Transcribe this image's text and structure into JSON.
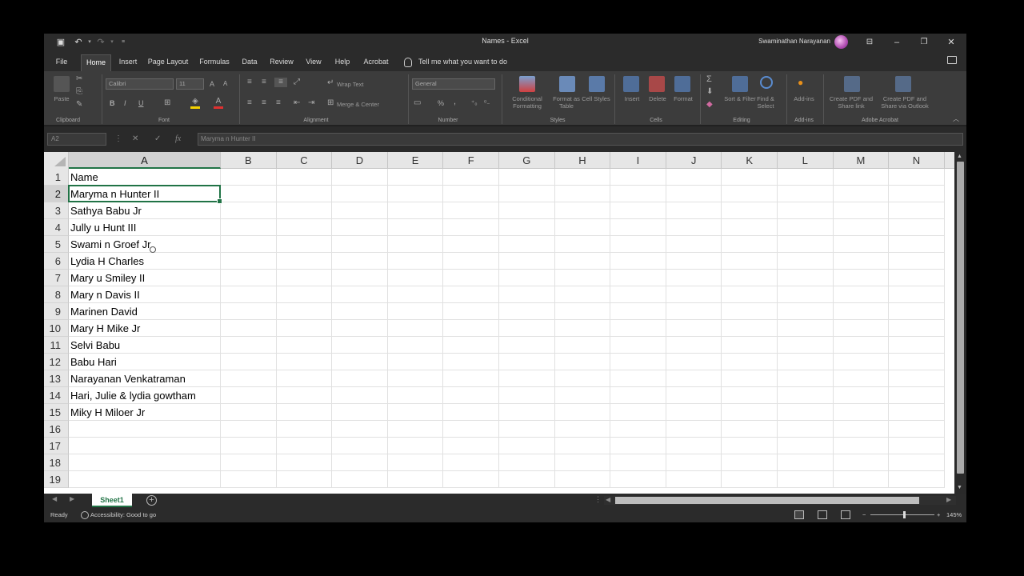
{
  "window": {
    "title": "Names - Excel",
    "user": "Swaminathan Narayanan"
  },
  "tabs": [
    "File",
    "Home",
    "Insert",
    "Page Layout",
    "Formulas",
    "Data",
    "Review",
    "View",
    "Help",
    "Acrobat"
  ],
  "active_tab": "Home",
  "tell_me": "Tell me what you want to do",
  "ribbon": {
    "clipboard": {
      "paste": "Paste",
      "label": "Clipboard"
    },
    "font": {
      "name": "Calibri",
      "size": "11",
      "bold": "B",
      "italic": "I",
      "underline": "U",
      "label": "Font"
    },
    "alignment": {
      "wrap": "Wrap Text",
      "merge": "Merge & Center",
      "label": "Alignment"
    },
    "number": {
      "format": "General",
      "percent": "%",
      "comma": ",",
      "label": "Number"
    },
    "styles": {
      "conditional": "Conditional Formatting",
      "format_table": "Format as Table",
      "cell_styles": "Cell Styles",
      "label": "Styles"
    },
    "cells": {
      "insert": "Insert",
      "delete": "Delete",
      "format": "Format",
      "label": "Cells"
    },
    "editing": {
      "sort": "Sort & Filter",
      "find": "Find & Select",
      "label": "Editing"
    },
    "addins": {
      "addins": "Add-ins",
      "label": "Add-ins"
    },
    "acrobat": {
      "create_share": "Create PDF and Share link",
      "create_outlook": "Create PDF and Share via Outlook",
      "label": "Adobe Acrobat"
    }
  },
  "formula_bar": {
    "name_box": "A2",
    "content": "Maryma n Hunter II",
    "fx": "fx"
  },
  "columns": [
    "A",
    "B",
    "C",
    "D",
    "E",
    "F",
    "G",
    "H",
    "I",
    "J",
    "K",
    "L",
    "M",
    "N"
  ],
  "rows": [
    "1",
    "2",
    "3",
    "4",
    "5",
    "6",
    "7",
    "8",
    "9",
    "10",
    "11",
    "12",
    "13",
    "14",
    "15",
    "16",
    "17",
    "18",
    "19"
  ],
  "cells_A": [
    "Name",
    "Maryma n Hunter II",
    "Sathya Babu Jr",
    "Jully u Hunt III",
    "Swami n Groef Jr",
    "Lydia H Charles",
    "Mary u Smiley II",
    "Mary n Davis II",
    "Marinen David",
    "Mary H Mike Jr",
    "Selvi Babu",
    "Babu Hari",
    "Narayanan Venkatraman",
    "Hari, Julie & lydia gowtham",
    "Miky H Miloer Jr"
  ],
  "sheet": {
    "name": "Sheet1",
    "add": "+"
  },
  "status": {
    "mode": "Ready",
    "accessibility": "Accessibility: Good to go",
    "zoom": "145%"
  },
  "colors": {
    "accent": "#217346",
    "ribbon_bg": "#3c3c3c",
    "title_bg": "#2b2b2b"
  }
}
